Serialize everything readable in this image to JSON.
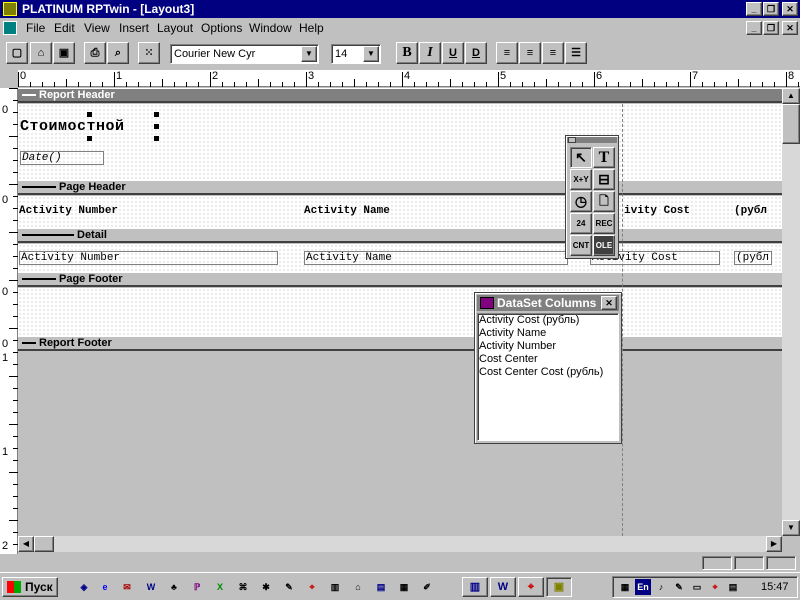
{
  "window": {
    "title": "PLATINUM RPTwin - [Layout3]"
  },
  "menu": [
    {
      "label": "File"
    },
    {
      "label": "Edit"
    },
    {
      "label": "View"
    },
    {
      "label": "Insert"
    },
    {
      "label": "Layout"
    },
    {
      "label": "Options"
    },
    {
      "label": "Window"
    },
    {
      "label": "Help"
    }
  ],
  "toolbar": {
    "font_name": "Courier New Cyr",
    "font_size": "14",
    "bold_label": "B",
    "italic_label": "I",
    "underline_label": "U",
    "strike_label": "D"
  },
  "ruler": {
    "top_marks": [
      "0",
      "1",
      "2",
      "3",
      "4",
      "5",
      "6",
      "7",
      "8"
    ],
    "left_marks": [
      "0",
      "0",
      "0",
      "0",
      "1",
      "1",
      "2"
    ]
  },
  "bands": {
    "report_header": "Report Header",
    "page_header": "Page Header",
    "detail": "Detail",
    "page_footer": "Page Footer",
    "report_footer": "Report Footer"
  },
  "report": {
    "title_text": "Стоимостной",
    "date_field": "Date()",
    "header_cols": [
      "Activity Number",
      "Activity Name",
      "ivity Cost",
      "(рубл"
    ],
    "detail_cols": [
      "Activity Number",
      "Activity Name",
      "Activity Cost",
      "(рубл"
    ]
  },
  "palette": {
    "buttons": [
      "pointer-icon",
      "text-icon",
      "formula-icon",
      "line-icon",
      "clock-icon",
      "page-icon",
      "date-icon",
      "rec-icon",
      "cnt-icon",
      "ole-icon"
    ],
    "labels": {
      "formula": "X+Y",
      "rec": "REC",
      "cnt": "CNT",
      "ole": "OLE",
      "date": "24",
      "text": "T"
    }
  },
  "dataset": {
    "title": "DataSet Columns",
    "columns": [
      "Activity Cost    (рубль)",
      "Activity Name",
      "Activity Number",
      "Cost Center",
      "Cost Center Cost (рубль)"
    ]
  },
  "taskbar": {
    "start_label": "Пуск",
    "clock": "15:47",
    "lang": "En"
  },
  "colors": {
    "titlebar": "#000080",
    "inactive_caption": "#808080",
    "face": "#c0c0c0"
  }
}
